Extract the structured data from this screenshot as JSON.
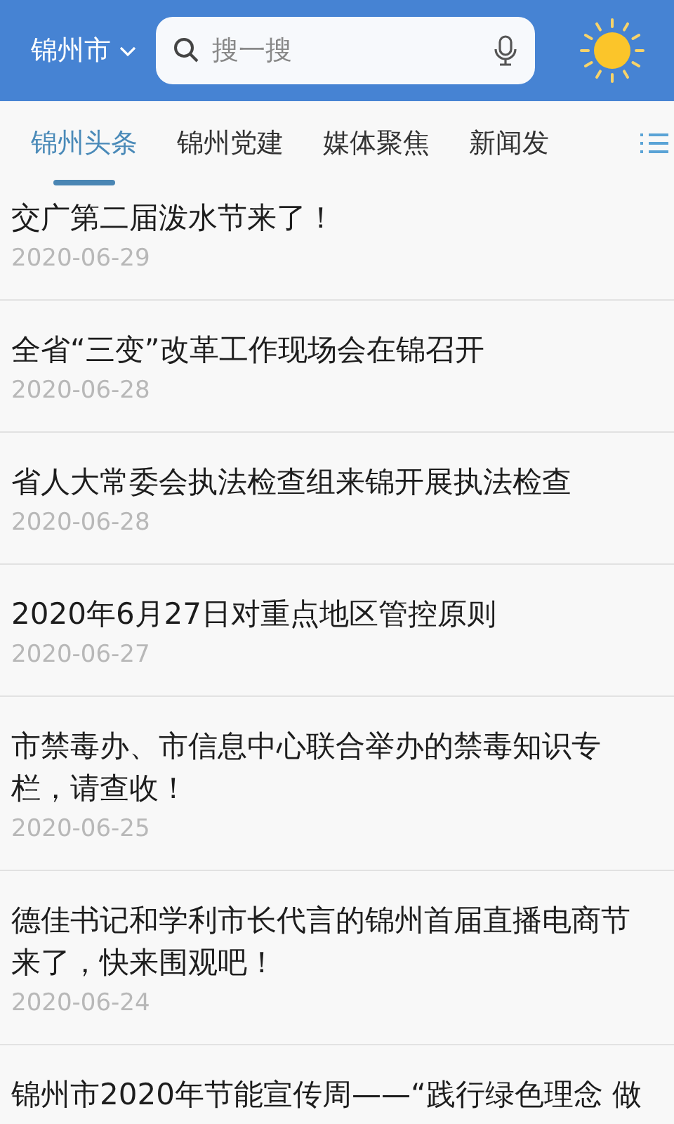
{
  "header": {
    "city": "锦州市",
    "search": {
      "placeholder": "搜一搜"
    }
  },
  "tabs": [
    {
      "label": "锦州头条",
      "selected": true
    },
    {
      "label": "锦州党建",
      "selected": false
    },
    {
      "label": "媒体聚焦",
      "selected": false
    },
    {
      "label": "新闻发",
      "selected": false
    }
  ],
  "articles": [
    {
      "title": "交广第二届泼水节来了！",
      "date": "2020-06-29"
    },
    {
      "title": "全省“三变”改革工作现场会在锦召开",
      "date": "2020-06-28"
    },
    {
      "title": "省人大常委会执法检查组来锦开展执法检查",
      "date": "2020-06-28"
    },
    {
      "title": "2020年6月27日对重点地区管控原则",
      "date": "2020-06-27"
    },
    {
      "title": "市禁毒办、市信息中心联合举办的禁毒知识专栏，请查收！",
      "date": "2020-06-25"
    },
    {
      "title": "德佳书记和学利市长代言的锦州首届直播电商节来了，快来围观吧！",
      "date": "2020-06-24"
    },
    {
      "title": "锦州市2020年节能宣传周——“践行绿色理念 做"
    }
  ]
}
